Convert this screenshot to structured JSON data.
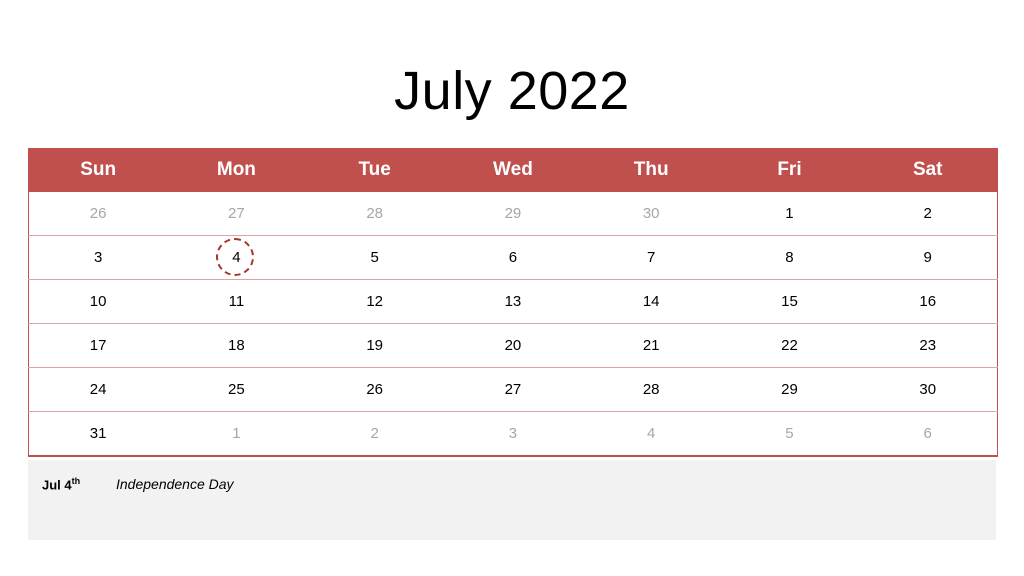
{
  "title": "July 2022",
  "calendar": {
    "weekday_headers": [
      "Sun",
      "Mon",
      "Tue",
      "Wed",
      "Thu",
      "Fri",
      "Sat"
    ],
    "weeks": [
      [
        {
          "day": "26",
          "month": "prev"
        },
        {
          "day": "27",
          "month": "prev"
        },
        {
          "day": "28",
          "month": "prev"
        },
        {
          "day": "29",
          "month": "prev"
        },
        {
          "day": "30",
          "month": "prev"
        },
        {
          "day": "1",
          "month": "current"
        },
        {
          "day": "2",
          "month": "current"
        }
      ],
      [
        {
          "day": "3",
          "month": "current"
        },
        {
          "day": "4",
          "month": "current",
          "highlighted": true
        },
        {
          "day": "5",
          "month": "current"
        },
        {
          "day": "6",
          "month": "current"
        },
        {
          "day": "7",
          "month": "current"
        },
        {
          "day": "8",
          "month": "current"
        },
        {
          "day": "9",
          "month": "current"
        }
      ],
      [
        {
          "day": "10",
          "month": "current"
        },
        {
          "day": "11",
          "month": "current"
        },
        {
          "day": "12",
          "month": "current"
        },
        {
          "day": "13",
          "month": "current"
        },
        {
          "day": "14",
          "month": "current"
        },
        {
          "day": "15",
          "month": "current"
        },
        {
          "day": "16",
          "month": "current"
        }
      ],
      [
        {
          "day": "17",
          "month": "current"
        },
        {
          "day": "18",
          "month": "current"
        },
        {
          "day": "19",
          "month": "current"
        },
        {
          "day": "20",
          "month": "current"
        },
        {
          "day": "21",
          "month": "current"
        },
        {
          "day": "22",
          "month": "current"
        },
        {
          "day": "23",
          "month": "current"
        }
      ],
      [
        {
          "day": "24",
          "month": "current"
        },
        {
          "day": "25",
          "month": "current"
        },
        {
          "day": "26",
          "month": "current"
        },
        {
          "day": "27",
          "month": "current"
        },
        {
          "day": "28",
          "month": "current"
        },
        {
          "day": "29",
          "month": "current"
        },
        {
          "day": "30",
          "month": "current"
        }
      ],
      [
        {
          "day": "31",
          "month": "current"
        },
        {
          "day": "1",
          "month": "next"
        },
        {
          "day": "2",
          "month": "next"
        },
        {
          "day": "3",
          "month": "next"
        },
        {
          "day": "4",
          "month": "next"
        },
        {
          "day": "5",
          "month": "next"
        },
        {
          "day": "6",
          "month": "next"
        }
      ]
    ]
  },
  "notes": [
    {
      "date_prefix": "Jul 4",
      "date_suffix": "th",
      "label": "Independence Day"
    }
  ],
  "colors": {
    "header_red": "#C0504D",
    "row_divider": "#D9A6A3",
    "muted_text": "#A6A6A6",
    "circle_mark": "#A8332C",
    "notes_background": "#F2F2F2"
  }
}
